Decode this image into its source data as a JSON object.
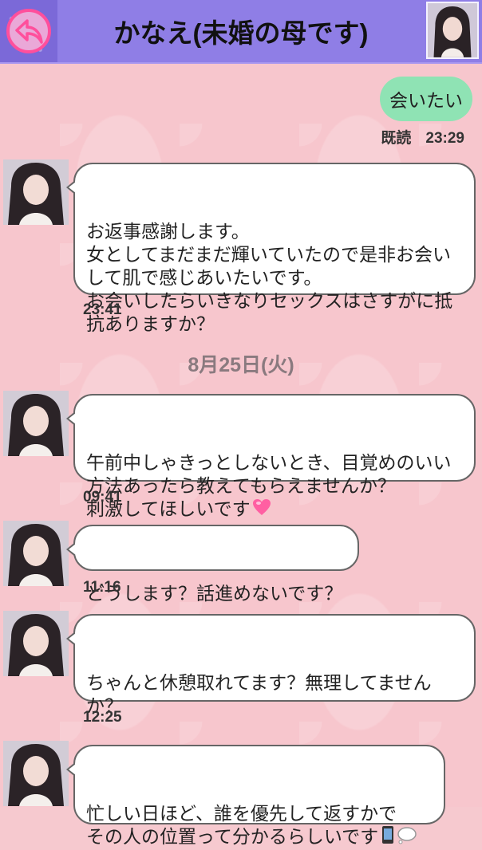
{
  "header": {
    "title": "かなえ(未婚の母です)",
    "back_icon": "back-arrow-icon",
    "accent": "#8f7ee6"
  },
  "sent": {
    "text": "会いたい",
    "read_label": "既読",
    "time": "23:29"
  },
  "date_separator": "8月25日(火)",
  "messages": [
    {
      "text": "お返事感謝します。\n女としてまだまだ輝いていたので是非お会い\nして肌で感じあいたいです。\nお会いしたらいきなりセックスはさすがに抵\n抗ありますか？",
      "time": "23:41"
    },
    {
      "text": "午前中しゃきっとしないとき、目覚めのいい\n方法あったら教えてもらえませんか？\n刺激してほしいです",
      "emoji": "pink-heart-icon",
      "time": "09:41"
    },
    {
      "text": "どうします？話進めないです？",
      "time": "11:16"
    },
    {
      "text": "ちゃんと休憩取れてます？無理してません\nか？",
      "time": "12:25"
    },
    {
      "text": "忙しい日ほど、誰を優先して返すかで\nその人の位置って分かるらしいです",
      "emoji": "phone-speech-icon",
      "time": ""
    }
  ]
}
